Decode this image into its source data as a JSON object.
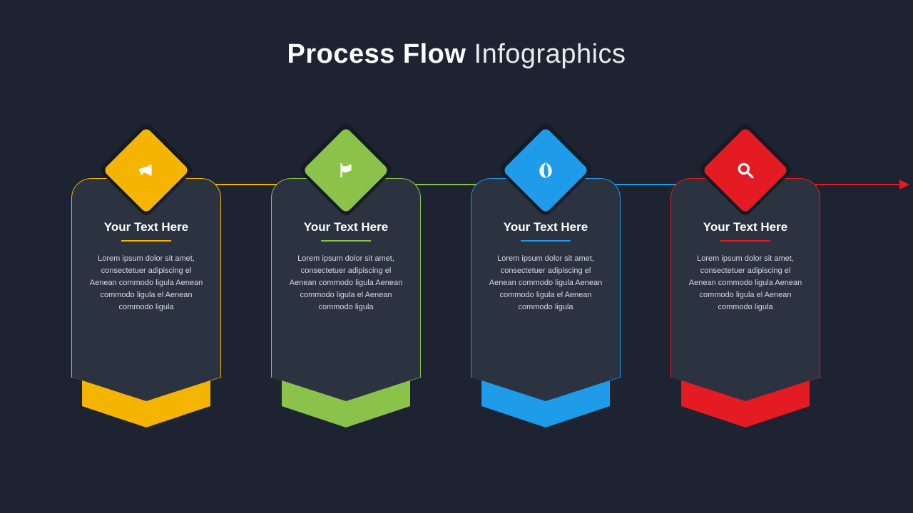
{
  "title_bold": "Process Flow",
  "title_light": " Infographics",
  "steps": [
    {
      "heading": "Your Text Here",
      "body": "Lorem ipsum dolor sit amet, consectetuer adipiscing el Aenean commodo ligula Aenean commodo ligula el Aenean commodo ligula",
      "color": "#f4b400",
      "icon": "megaphone"
    },
    {
      "heading": "Your Text Here",
      "body": "Lorem ipsum dolor sit amet, consectetuer adipiscing el Aenean commodo ligula Aenean commodo ligula el Aenean commodo ligula",
      "color": "#8bc34a",
      "icon": "flag"
    },
    {
      "heading": "Your Text Here",
      "body": "Lorem ipsum dolor sit amet, consectetuer adipiscing el Aenean commodo ligula Aenean commodo ligula el Aenean commodo ligula",
      "color": "#1e9be9",
      "icon": "leaf"
    },
    {
      "heading": "Your Text Here",
      "body": "Lorem ipsum dolor sit amet, consectetuer adipiscing el Aenean commodo ligula Aenean commodo ligula el Aenean commodo ligula",
      "color": "#e51b23",
      "icon": "search"
    }
  ]
}
